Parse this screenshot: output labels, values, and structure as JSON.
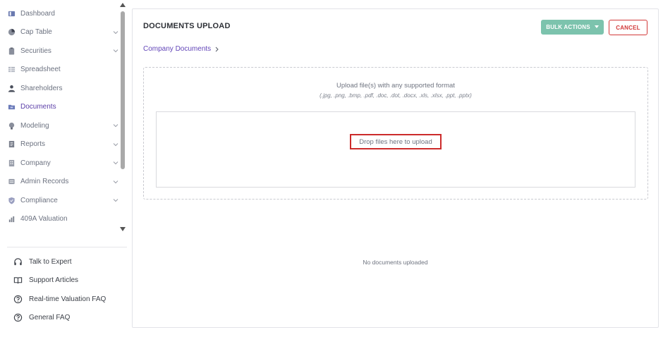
{
  "sidebar": {
    "nav": [
      {
        "label": "Dashboard",
        "icon": "dashboard-icon",
        "chevron": false,
        "active": false
      },
      {
        "label": "Cap Table",
        "icon": "pie-chart-icon",
        "chevron": true,
        "active": false
      },
      {
        "label": "Securities",
        "icon": "clipboard-icon",
        "chevron": true,
        "active": false
      },
      {
        "label": "Spreadsheet",
        "icon": "spreadsheet-icon",
        "chevron": false,
        "active": false
      },
      {
        "label": "Shareholders",
        "icon": "user-icon",
        "chevron": false,
        "active": false
      },
      {
        "label": "Documents",
        "icon": "folder-icon",
        "chevron": false,
        "active": true
      },
      {
        "label": "Modeling",
        "icon": "lightbulb-icon",
        "chevron": true,
        "active": false
      },
      {
        "label": "Reports",
        "icon": "report-icon",
        "chevron": true,
        "active": false
      },
      {
        "label": "Company",
        "icon": "building-icon",
        "chevron": true,
        "active": false
      },
      {
        "label": "Admin Records",
        "icon": "admin-records-icon",
        "chevron": true,
        "active": false
      },
      {
        "label": "Compliance",
        "icon": "shield-icon",
        "chevron": true,
        "active": false
      },
      {
        "label": "409A Valuation",
        "icon": "valuation-chart-icon",
        "chevron": false,
        "active": false
      }
    ],
    "help": [
      {
        "label": "Talk to Expert",
        "icon": "headphones-icon"
      },
      {
        "label": "Support Articles",
        "icon": "book-icon"
      },
      {
        "label": "Real-time Valuation FAQ",
        "icon": "question-circle-icon"
      },
      {
        "label": "General FAQ",
        "icon": "question-circle-icon"
      }
    ]
  },
  "main": {
    "title": "DOCUMENTS UPLOAD",
    "bulk_actions_label": "BULK ACTIONS",
    "cancel_label": "CANCEL",
    "breadcrumb": "Company Documents",
    "upload_text": "Upload file(s) with any supported format",
    "upload_formats": "(.jpg, .png, .bmp, .pdf, .doc, .dot, .docx, .xls, .xlsx, .ppt, .pptx)",
    "drop_label": "Drop files here to upload",
    "empty_state": "No documents uploaded"
  },
  "colors": {
    "accent": "#6245b8",
    "bulk_button": "#7cc3ad",
    "cancel": "#d23a3a",
    "highlight_border": "#cc2b2b"
  }
}
